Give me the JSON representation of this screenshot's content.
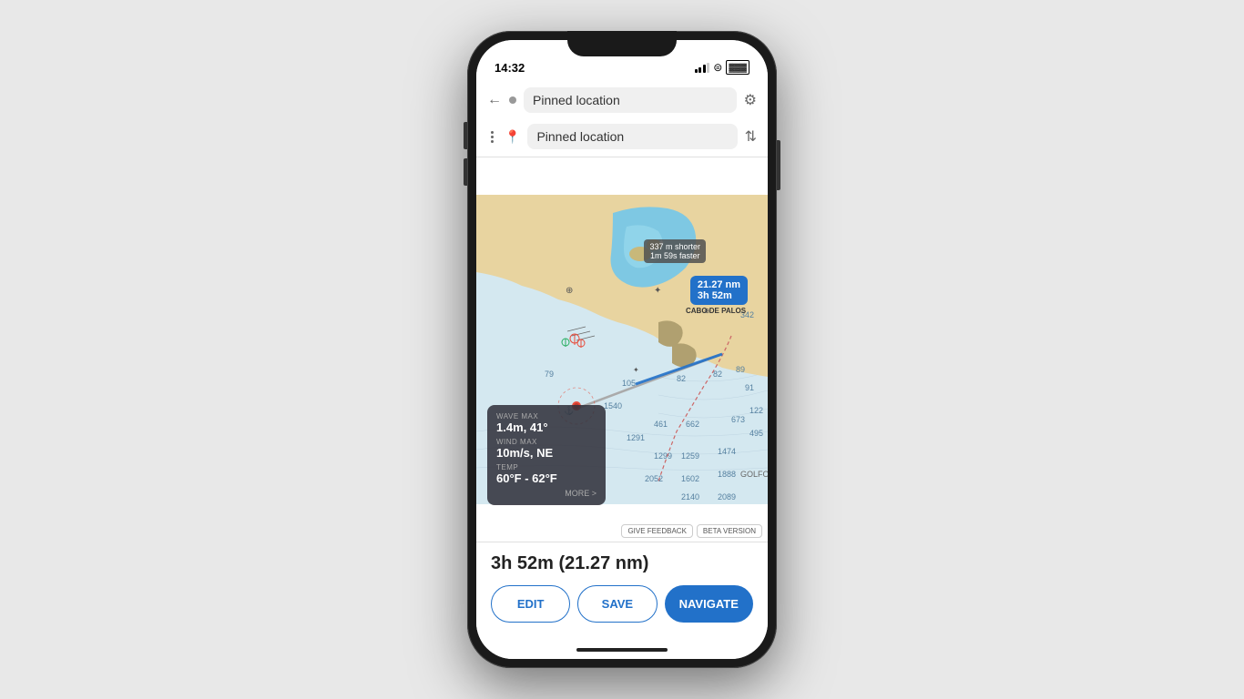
{
  "phone": {
    "status": {
      "time": "14:32",
      "signal_icon": "signal",
      "wifi_icon": "wifi",
      "battery_icon": "battery"
    }
  },
  "navigation": {
    "back_label": "←",
    "origin_placeholder": "Pinned location",
    "origin_value": "Pinned location",
    "destination_placeholder": "Pinned location",
    "destination_value": "Pinned location",
    "settings_label": "⚙",
    "swap_label": "⇅",
    "more_label": "⋮"
  },
  "map": {
    "distance_tooltip": {
      "line1": "21.27 nm",
      "line2": "3h 52m"
    },
    "shortcut_tooltip": {
      "line1": "337 m shorter",
      "line2": "1m 59s faster"
    },
    "location_name": "CABO DE PALOS",
    "location_name2": "GOLFO"
  },
  "weather": {
    "wave_label": "WAVE MAX",
    "wave_value": "1.4m, 41°",
    "wind_label": "WIND MAX",
    "wind_value": "10m/s, NE",
    "temp_label": "TEMP",
    "temp_value": "60°F - 62°F",
    "more_label": "MORE >"
  },
  "feedback": {
    "feedback_btn": "GIVE FEEDBACK",
    "beta_btn": "BETA VERSION"
  },
  "bottom": {
    "trip_time": "3h 52m (21.27 nm)",
    "edit_label": "EDIT",
    "save_label": "SAVE",
    "navigate_label": "NAVIGATE"
  }
}
